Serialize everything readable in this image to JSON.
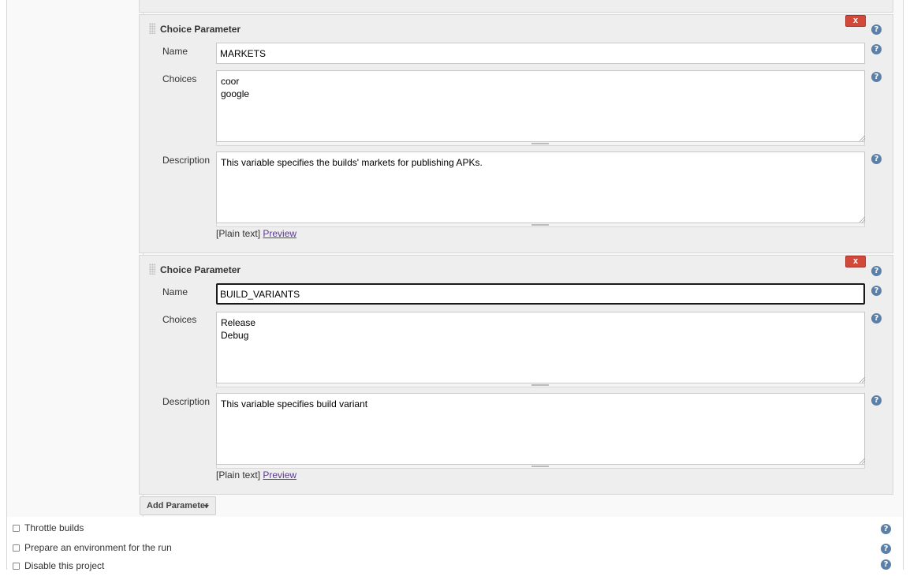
{
  "help_glyph": "?",
  "parameters": [
    {
      "title": "Choice Parameter",
      "delete_label": "x",
      "name_label": "Name",
      "name_value": "MARKETS",
      "choices_label": "Choices",
      "choices_value": "coor\ngoogle",
      "description_label": "Description",
      "description_value": "This variable specifies the builds' markets for publishing APKs.",
      "format_note": "[Plain text]",
      "preview_label": "Preview"
    },
    {
      "title": "Choice Parameter",
      "delete_label": "x",
      "name_label": "Name",
      "name_value": "BUILD_VARIANTS",
      "choices_label": "Choices",
      "choices_value": "Release\nDebug",
      "description_label": "Description",
      "description_value": "This variable specifies build variant",
      "format_note": "[Plain text]",
      "preview_label": "Preview"
    }
  ],
  "add_parameter_label": "Add Parameter",
  "options": [
    {
      "label": "Throttle builds",
      "checked": false
    },
    {
      "label": "Prepare an environment for the run",
      "checked": false
    },
    {
      "label": "Disable this project",
      "checked": false
    }
  ],
  "colors": {
    "delete_button": "#d24939",
    "help_icon": "#5b7fa6",
    "link": "#5a3a8a"
  }
}
